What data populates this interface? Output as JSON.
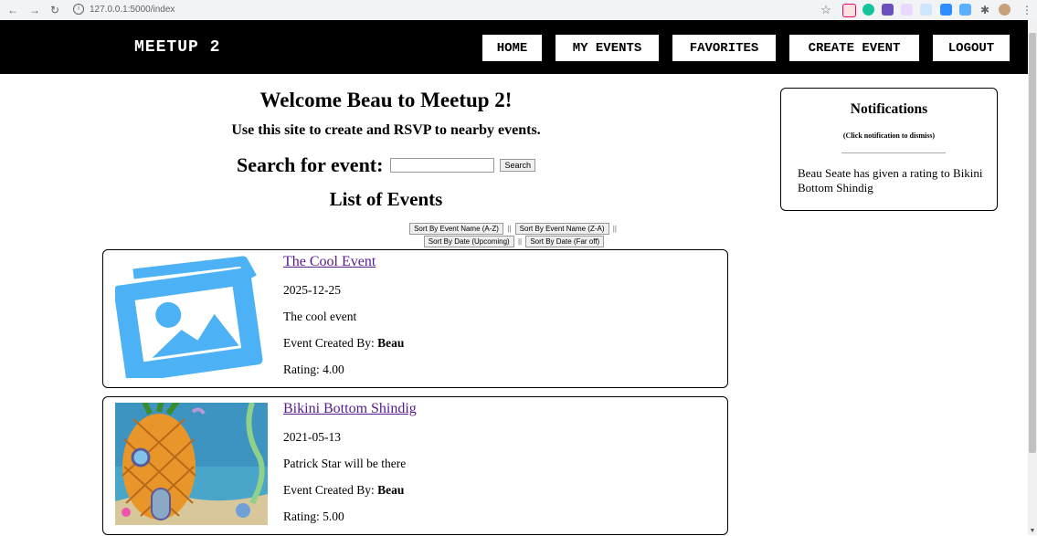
{
  "browser": {
    "url_host": "127.0.0.1",
    "url_path": ":5000/index"
  },
  "header": {
    "brand": "MEETUP 2",
    "nav": {
      "home": "HOME",
      "my_events": "MY EVENTS",
      "favorites": "FAVORITES",
      "create_event": "CREATE EVENT",
      "logout": "LOGOUT"
    }
  },
  "main": {
    "welcome": "Welcome Beau to Meetup 2!",
    "tagline": "Use this site to create and RSVP to nearby events.",
    "search_label": "Search for event:",
    "search_value": "",
    "search_button": "Search",
    "list_title": "List of Events",
    "sort": {
      "name_az": "Sort By Event Name (A-Z)",
      "name_za": "Sort By Event Name (Z-A)",
      "date_upcoming": "Sort By Date (Upcoming)",
      "date_far": "Sort By Date (Far off)",
      "separator": "||"
    },
    "events": [
      {
        "title": "The Cool Event",
        "date": "2025-12-25",
        "description": "The cool event",
        "created_by_label": "Event Created By:",
        "creator": "Beau",
        "rating_label": "Rating:",
        "rating": "4.00",
        "image_icon": "placeholder-image-icon"
      },
      {
        "title": "Bikini Bottom Shindig",
        "date": "2021-05-13",
        "description": "Patrick Star will be there",
        "created_by_label": "Event Created By:",
        "creator": "Beau",
        "rating_label": "Rating:",
        "rating": "5.00",
        "image_icon": "pineapple-house-image"
      }
    ]
  },
  "notifications": {
    "title": "Notifications",
    "hint": "(Click notification to dismiss)",
    "items": [
      "Beau Seate has given a rating to Bikini Bottom Shindig"
    ]
  },
  "colors": {
    "header_bg": "#000000",
    "link_visited": "#551a8b",
    "placeholder_icon": "#4db1f5"
  }
}
